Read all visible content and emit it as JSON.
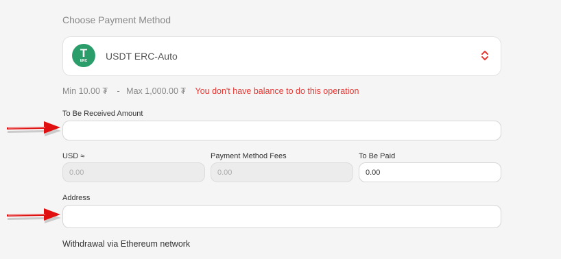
{
  "section_title": "Choose Payment Method",
  "payment_method": {
    "selected": "USDT ERC-Auto",
    "icon": "tether-erc-icon",
    "icon_glyph": "T",
    "icon_subtext": "ERC"
  },
  "limits": {
    "min": "Min 10.00 ₮",
    "separator": "-",
    "max": "Max 1,000.00 ₮",
    "error": "You don't have balance to do this operation"
  },
  "fields": {
    "received_amount": {
      "label": "To Be Received Amount",
      "value": ""
    },
    "usd": {
      "label": "USD ≈",
      "value": "0.00"
    },
    "fees": {
      "label": "Payment Method Fees",
      "value": "0.00"
    },
    "to_be_paid": {
      "label": "To Be Paid",
      "value": "0.00"
    },
    "address": {
      "label": "Address",
      "value": ""
    }
  },
  "footer_note": "Withdrawal via Ethereum network",
  "colors": {
    "error": "#e53935",
    "chevron": "#e53935",
    "coin": "#2a9d6a",
    "arrow": "#e01010"
  }
}
